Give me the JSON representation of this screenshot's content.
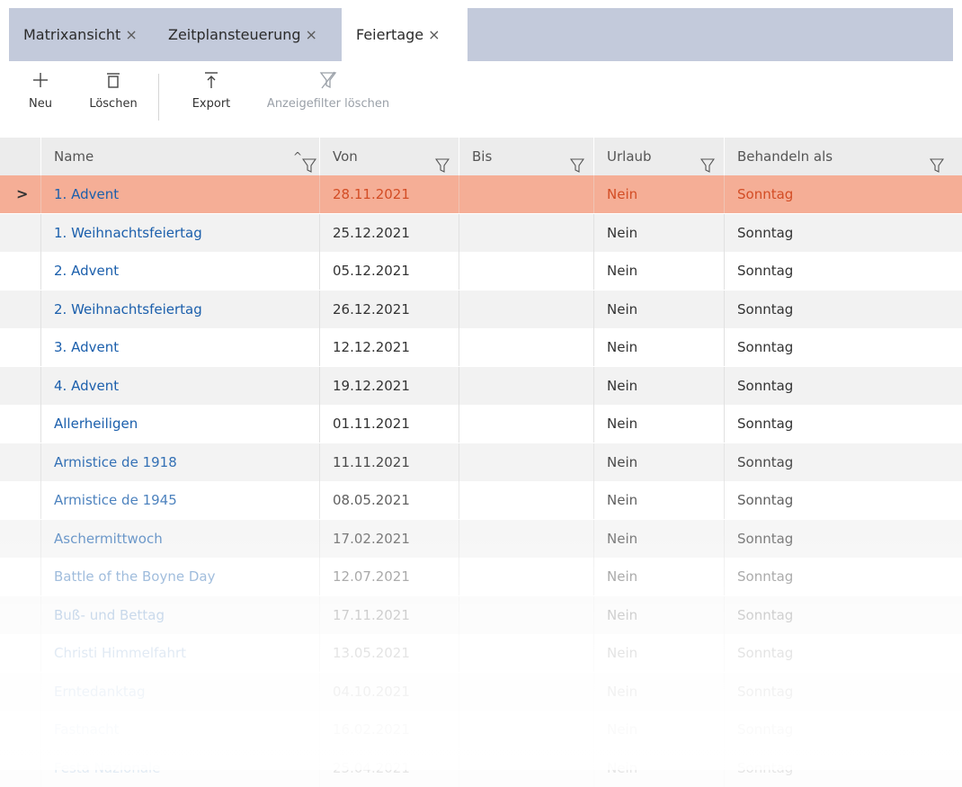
{
  "tabs": [
    {
      "label": "Matrixansicht",
      "close": "×"
    },
    {
      "label": "Zeitplansteuerung",
      "close": "×"
    },
    {
      "label": "Feiertage",
      "close": "×"
    }
  ],
  "toolbar": {
    "new_label": "Neu",
    "delete_label": "Löschen",
    "export_label": "Export",
    "clear_filter_label": "Anzeigefilter löschen"
  },
  "columns": {
    "name": "Name",
    "sort_indicator": "^",
    "from": "Von",
    "to": "Bis",
    "vacation": "Urlaub",
    "treat_as": "Behandeln als"
  },
  "selection_marker": ">",
  "rows": [
    {
      "name": "1. Advent",
      "from": "28.11.2021",
      "to": "",
      "vacation": "Nein",
      "treat_as": "Sonntag"
    },
    {
      "name": "1. Weihnachtsfeiertag",
      "from": "25.12.2021",
      "to": "",
      "vacation": "Nein",
      "treat_as": "Sonntag"
    },
    {
      "name": "2. Advent",
      "from": "05.12.2021",
      "to": "",
      "vacation": "Nein",
      "treat_as": "Sonntag"
    },
    {
      "name": "2. Weihnachtsfeiertag",
      "from": "26.12.2021",
      "to": "",
      "vacation": "Nein",
      "treat_as": "Sonntag"
    },
    {
      "name": "3. Advent",
      "from": "12.12.2021",
      "to": "",
      "vacation": "Nein",
      "treat_as": "Sonntag"
    },
    {
      "name": "4. Advent",
      "from": "19.12.2021",
      "to": "",
      "vacation": "Nein",
      "treat_as": "Sonntag"
    },
    {
      "name": "Allerheiligen",
      "from": "01.11.2021",
      "to": "",
      "vacation": "Nein",
      "treat_as": "Sonntag"
    },
    {
      "name": "Armistice de 1918",
      "from": "11.11.2021",
      "to": "",
      "vacation": "Nein",
      "treat_as": "Sonntag"
    },
    {
      "name": "Armistice de 1945",
      "from": "08.05.2021",
      "to": "",
      "vacation": "Nein",
      "treat_as": "Sonntag"
    },
    {
      "name": "Aschermittwoch",
      "from": "17.02.2021",
      "to": "",
      "vacation": "Nein",
      "treat_as": "Sonntag"
    },
    {
      "name": "Battle of the Boyne Day",
      "from": "12.07.2021",
      "to": "",
      "vacation": "Nein",
      "treat_as": "Sonntag"
    },
    {
      "name": "Buß- und Bettag",
      "from": "17.11.2021",
      "to": "",
      "vacation": "Nein",
      "treat_as": "Sonntag"
    },
    {
      "name": "Christi Himmelfahrt",
      "from": "13.05.2021",
      "to": "",
      "vacation": "Nein",
      "treat_as": "Sonntag"
    },
    {
      "name": "Erntedanktag",
      "from": "04.10.2021",
      "to": "",
      "vacation": "Nein",
      "treat_as": "Sonntag"
    },
    {
      "name": "Fastnacht",
      "from": "16.02.2021",
      "to": "",
      "vacation": "Nein",
      "treat_as": "Sonntag"
    },
    {
      "name": "Festa Nazionale",
      "from": "25.04.2021",
      "to": "",
      "vacation": "Nein",
      "treat_as": "Sonntag"
    }
  ],
  "colors": {
    "selected_row": "#f5ae96",
    "selected_text": "#d34d25",
    "link_text": "#1b5fac",
    "tabbar": "#c3cadb"
  },
  "icons": [
    "plus-icon",
    "trash-icon",
    "export-icon",
    "filter-clear-icon",
    "filter-icon",
    "sort-asc-icon"
  ]
}
